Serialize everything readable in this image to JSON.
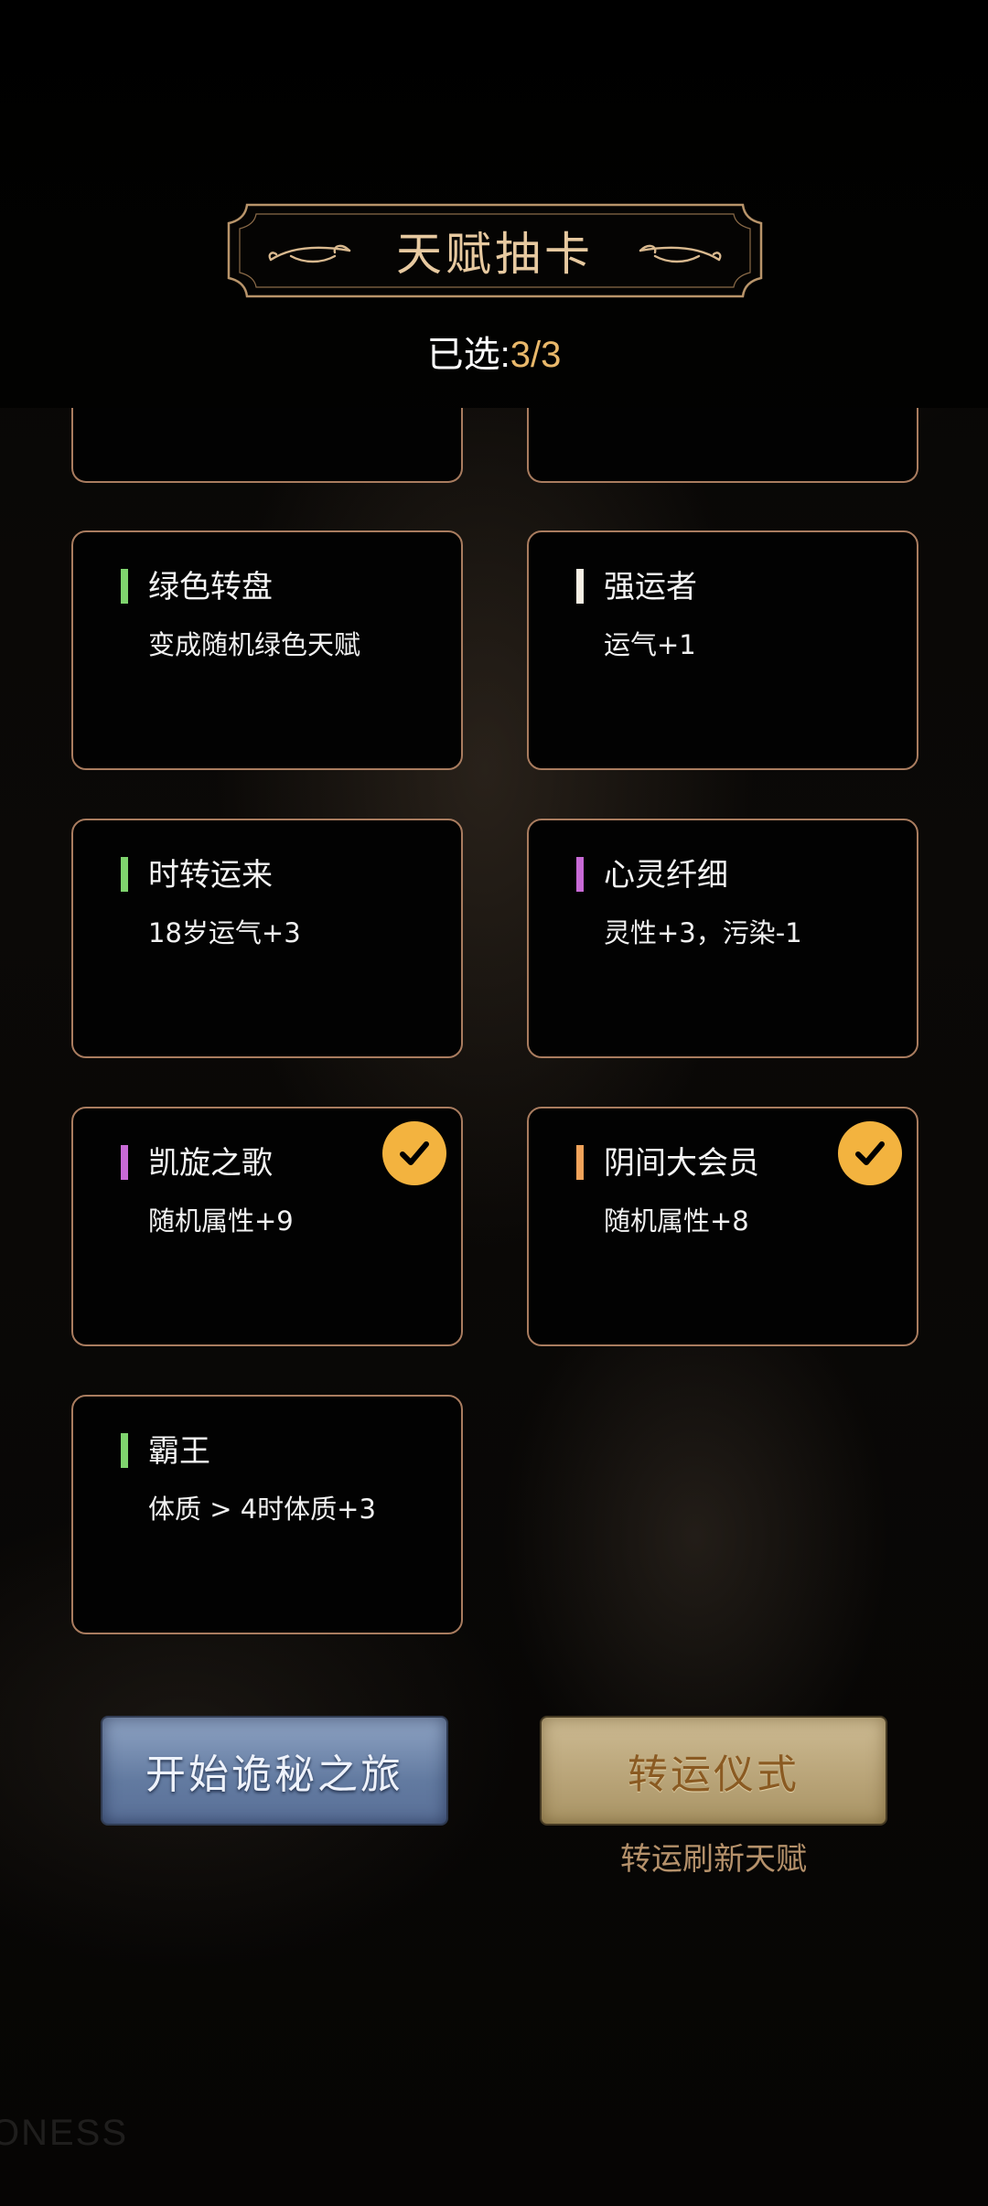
{
  "header": {
    "title": "天赋抽卡",
    "selected_label": "已选:",
    "selected_count": "3/3"
  },
  "cards": [
    {
      "name": "绿色转盘",
      "desc": "变成随机绿色天赋",
      "rarity_color": "#7fd46e",
      "selected": false
    },
    {
      "name": "强运者",
      "desc": "运气+1",
      "rarity_color": "#f6efe4",
      "selected": false
    },
    {
      "name": "时转运来",
      "desc": "18岁运气+3",
      "rarity_color": "#7fd46e",
      "selected": false
    },
    {
      "name": "心灵纤细",
      "desc": "灵性+3，污染-1",
      "rarity_color": "#c86ad6",
      "selected": false
    },
    {
      "name": "凯旋之歌",
      "desc": "随机属性+9",
      "rarity_color": "#c86ad6",
      "selected": true
    },
    {
      "name": "阴间大会员",
      "desc": "随机属性+8",
      "rarity_color": "#f2a35a",
      "selected": true
    },
    {
      "name": "霸王",
      "desc": "体质 > 4时体质+3",
      "rarity_color": "#7fd46e",
      "selected": false
    }
  ],
  "buttons": {
    "start": "开始诡秘之旅",
    "fortune": "转运仪式",
    "fortune_sub": "转运刷新天赋"
  },
  "watermark": "ONESS",
  "colors": {
    "accent_gold": "#e9b86a",
    "card_border": "#a97c5f",
    "check_yellow": "#f3b33f"
  }
}
